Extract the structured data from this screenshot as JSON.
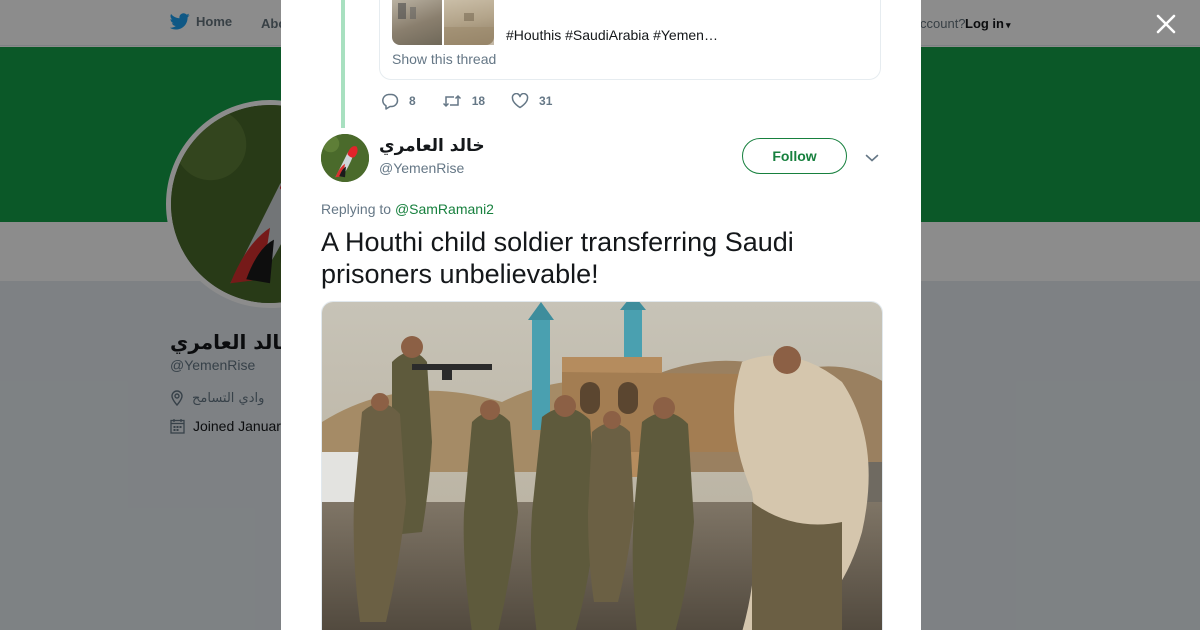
{
  "nav": {
    "home_label": "Home",
    "about_label": "Abo",
    "account_prompt": "ccount?",
    "login_label": "Log in"
  },
  "profile": {
    "name": "خالد العامري",
    "handle": "@YemenRise",
    "location": "وادي التسامح",
    "joined": "Joined Januar"
  },
  "quoted_tweet": {
    "hashtags": "#Houthis #SaudiArabia #Yemen…",
    "show_thread_label": "Show this thread"
  },
  "previous_actions": {
    "replies": "8",
    "retweets": "18",
    "likes": "31"
  },
  "tweet": {
    "author_name": "خالد العامري",
    "author_handle": "@YemenRise",
    "follow_label": "Follow",
    "replying_prefix": "Replying to",
    "replying_to": "@SamRamani2",
    "text": "A Houthi child soldier transferring Saudi prisoners  unbelievable!"
  },
  "icons": {
    "brand": "twitter-bird-icon",
    "reply": "reply-icon",
    "retweet": "retweet-icon",
    "like": "heart-icon",
    "close": "close-icon",
    "more": "chevron-down-icon",
    "location": "location-pin-icon",
    "calendar": "calendar-icon"
  },
  "colors": {
    "brand_blue": "#1da1f2",
    "accent_green": "#17803e",
    "banner_green": "#14a14a",
    "thread_line": "#a8e0c0",
    "muted_text": "#657786"
  }
}
